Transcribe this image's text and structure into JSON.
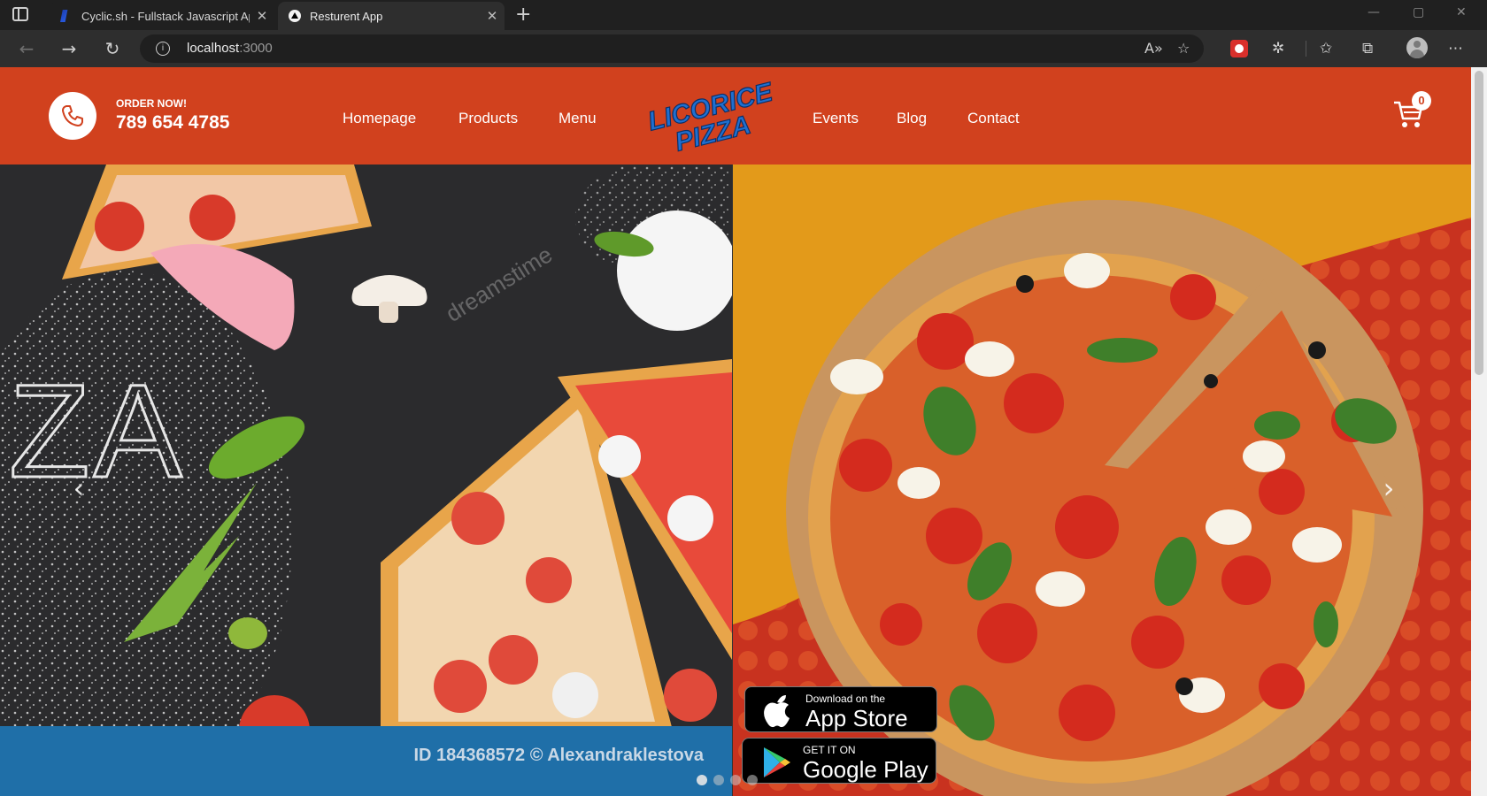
{
  "browser": {
    "tabs": [
      {
        "title": "Cyclic.sh - Fullstack Javascript Ap",
        "favicon": "cyclic-icon",
        "active": false
      },
      {
        "title": "Resturent App",
        "favicon": "nextjs-icon",
        "active": true
      }
    ],
    "close_glyph": "✕",
    "new_tab_glyph": "+",
    "address": {
      "host": "localhost",
      "port": ":3000"
    },
    "window_controls": {
      "minimize": "—",
      "maximize": "▢",
      "close": "✕"
    }
  },
  "header": {
    "order_label": "ORDER NOW!",
    "phone": "789 654 4785",
    "nav_left": [
      "Homepage",
      "Products",
      "Menu"
    ],
    "nav_right": [
      "Events",
      "Blog",
      "Contact"
    ],
    "logo_lines": [
      "LICORICE",
      "PIZZA"
    ],
    "cart_count": "0",
    "colors": {
      "header_bg": "#d1411e",
      "logo_blue": "#1f6fd0"
    }
  },
  "slider": {
    "left_slide": {
      "big_text": "ZA",
      "watermark": "dreamstime",
      "credit": "ID 184368572 © Alexandraklestova"
    },
    "right_slide": {
      "app_store": {
        "small": "Download on the",
        "big": "App Store"
      },
      "google_play": {
        "small": "GET IT ON",
        "big": "Google Play"
      }
    },
    "prev_glyph": "‹",
    "next_glyph": "›",
    "dots": 4,
    "active_dot": 0
  }
}
